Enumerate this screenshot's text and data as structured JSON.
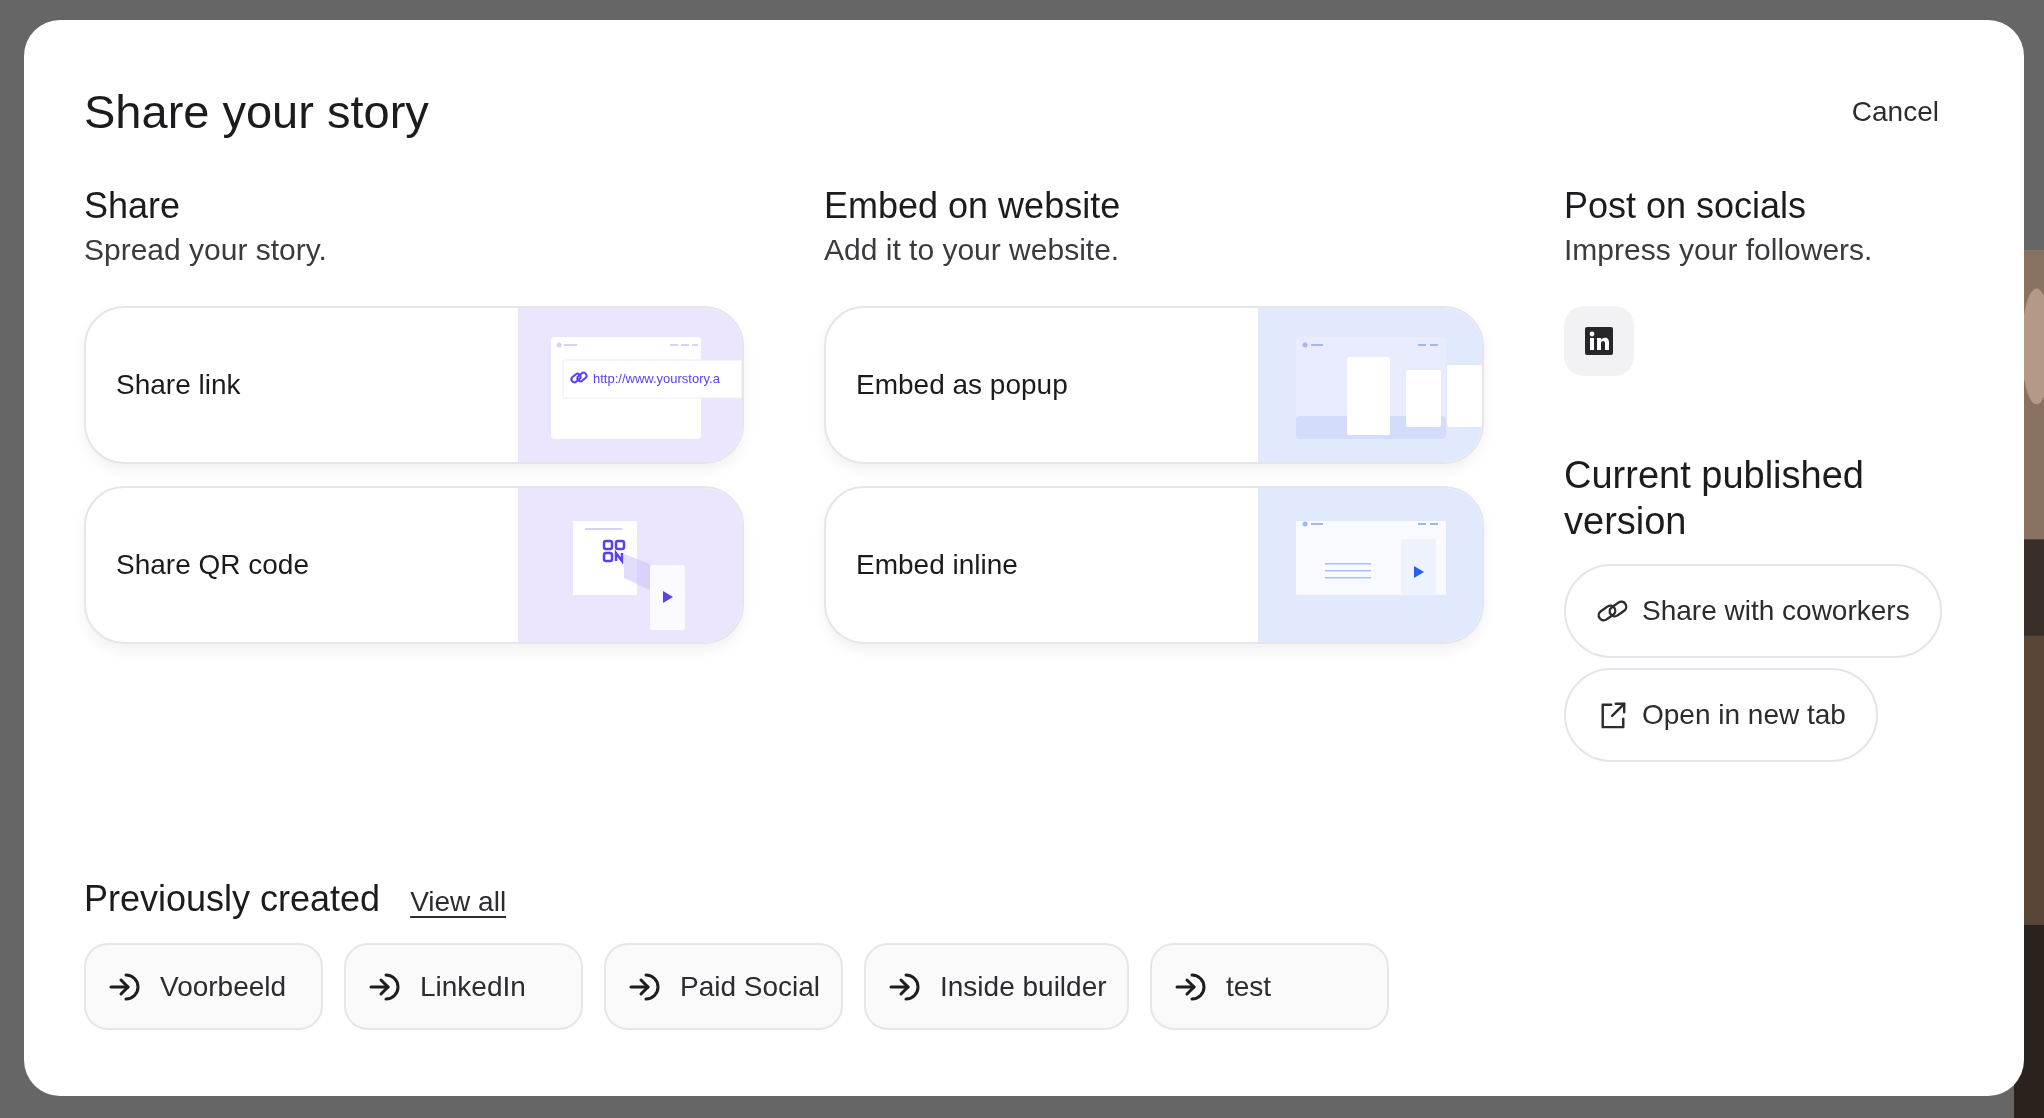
{
  "dialog": {
    "title": "Share your story",
    "cancel": "Cancel"
  },
  "sections": [
    {
      "kind": "cards",
      "heading": "Share",
      "subtitle": "Spread your story.",
      "options": [
        {
          "label": "Share link",
          "kind": "link",
          "url": "http://www.yourstory.a"
        },
        {
          "label": "Share QR code",
          "kind": "qr"
        }
      ]
    },
    {
      "kind": "cards",
      "heading": "Embed on website",
      "subtitle": "Add it to your website.",
      "options": [
        {
          "label": "Embed as popup",
          "kind": "popup"
        },
        {
          "label": "Embed inline",
          "kind": "inline"
        }
      ]
    },
    {
      "kind": "socials",
      "heading": "Post on socials",
      "subtitle": "Impress your followers.",
      "networks": [
        {
          "kind": "linkedin"
        }
      ],
      "published": {
        "heading": "Current published version",
        "actions": [
          {
            "label": "Share with coworkers",
            "kind": "share"
          },
          {
            "label": "Open in new tab",
            "kind": "open"
          }
        ]
      }
    }
  ],
  "previous": {
    "heading": "Previously created",
    "link": "View all",
    "items": [
      {
        "label": "Voorbeeld"
      },
      {
        "label": "LinkedIn"
      },
      {
        "label": "Paid Social"
      },
      {
        "label": "Inside builder"
      },
      {
        "label": "test"
      }
    ]
  }
}
